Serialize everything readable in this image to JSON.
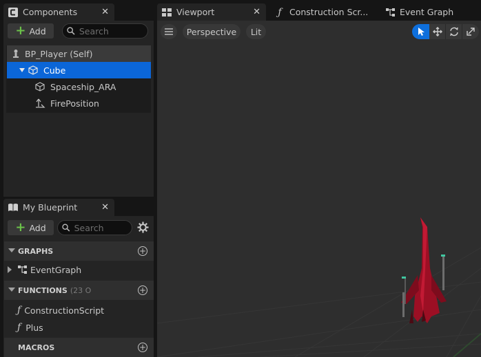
{
  "components_panel": {
    "tab_title": "Components",
    "add_label": "Add",
    "search_placeholder": "Search",
    "tree": [
      {
        "label": "BP_Player (Self)",
        "icon": "pawn-icon"
      },
      {
        "label": "Cube",
        "icon": "static-mesh-icon",
        "selected": true
      },
      {
        "label": "Spaceship_ARA",
        "icon": "static-mesh-icon"
      },
      {
        "label": "FirePosition",
        "icon": "arrow-component-icon"
      }
    ]
  },
  "blueprint_panel": {
    "tab_title": "My Blueprint",
    "add_label": "Add",
    "search_placeholder": "Search",
    "sections": {
      "graphs": {
        "title": "GRAPHS",
        "items": [
          "EventGraph"
        ]
      },
      "functions": {
        "title": "FUNCTIONS",
        "count_text": "(23 O",
        "items": [
          "ConstructionScript",
          "Plus"
        ]
      },
      "macros": {
        "title": "MACROS"
      }
    }
  },
  "editor_tabs": [
    {
      "label": "Viewport",
      "icon": "viewport-icon",
      "active": true
    },
    {
      "label": "Construction Scr...",
      "icon": "function-icon"
    },
    {
      "label": "Event Graph",
      "icon": "graph-icon"
    }
  ],
  "viewport": {
    "menu_icon": "hamburger-icon",
    "view_mode": "Perspective",
    "lighting_mode": "Lit",
    "tools": [
      "select-icon",
      "translate-icon",
      "rotate-icon",
      "scale-icon"
    ],
    "colors": {
      "accent": "#0e6fdc",
      "selection": "#0b66d8",
      "ship": "#b8102a"
    }
  }
}
